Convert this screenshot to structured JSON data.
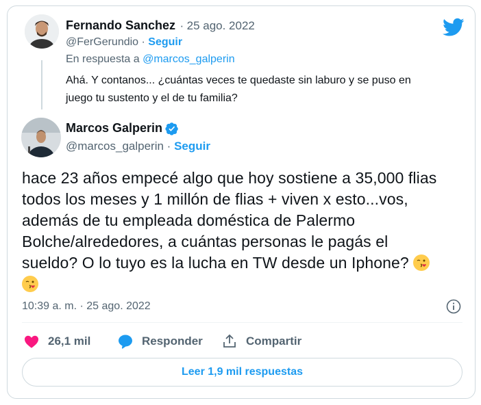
{
  "reply_tweet": {
    "author_name": "Fernando Sanchez",
    "separator": "·",
    "date": "25 ago. 2022",
    "handle": "@FerGerundio",
    "follow_label": "Seguir",
    "in_reply_prefix": "En respuesta a",
    "in_reply_handle": "@marcos_galperin",
    "text_line1": "Ahá. Y contanos... ¿cuántas veces te quedaste sin laburo y se puso en",
    "text_line2": "juego tu sustento y el de tu familia?"
  },
  "main_tweet": {
    "author_name": "Marcos Galperin",
    "handle": "@marcos_galperin",
    "follow_label": "Seguir",
    "verified_icon": "verified-badge-icon",
    "text_lines": [
      "hace 23 años empecé algo que hoy sostiene a 35,000 flias",
      "todos los meses y 1 millón de flias + viven x esto...vos,",
      "además de tu empleada doméstica de Palermo",
      "Bolche/alrededores, a cuántas personas le pagás el",
      "sueldo? O lo tuyo es la lucha en TW desde un Iphone?"
    ],
    "emoji": "winking-kiss-emoji",
    "timestamp": "10:39 a. m. · 25 ago. 2022"
  },
  "actions": {
    "likes_count": "26,1 mil",
    "reply_label": "Responder",
    "share_label": "Compartir"
  },
  "read_more_label": "Leer 1,9 mil respuestas",
  "colors": {
    "accent": "#1d9bf0",
    "like": "#f91880",
    "muted": "#536471",
    "border": "#cfd9de"
  }
}
